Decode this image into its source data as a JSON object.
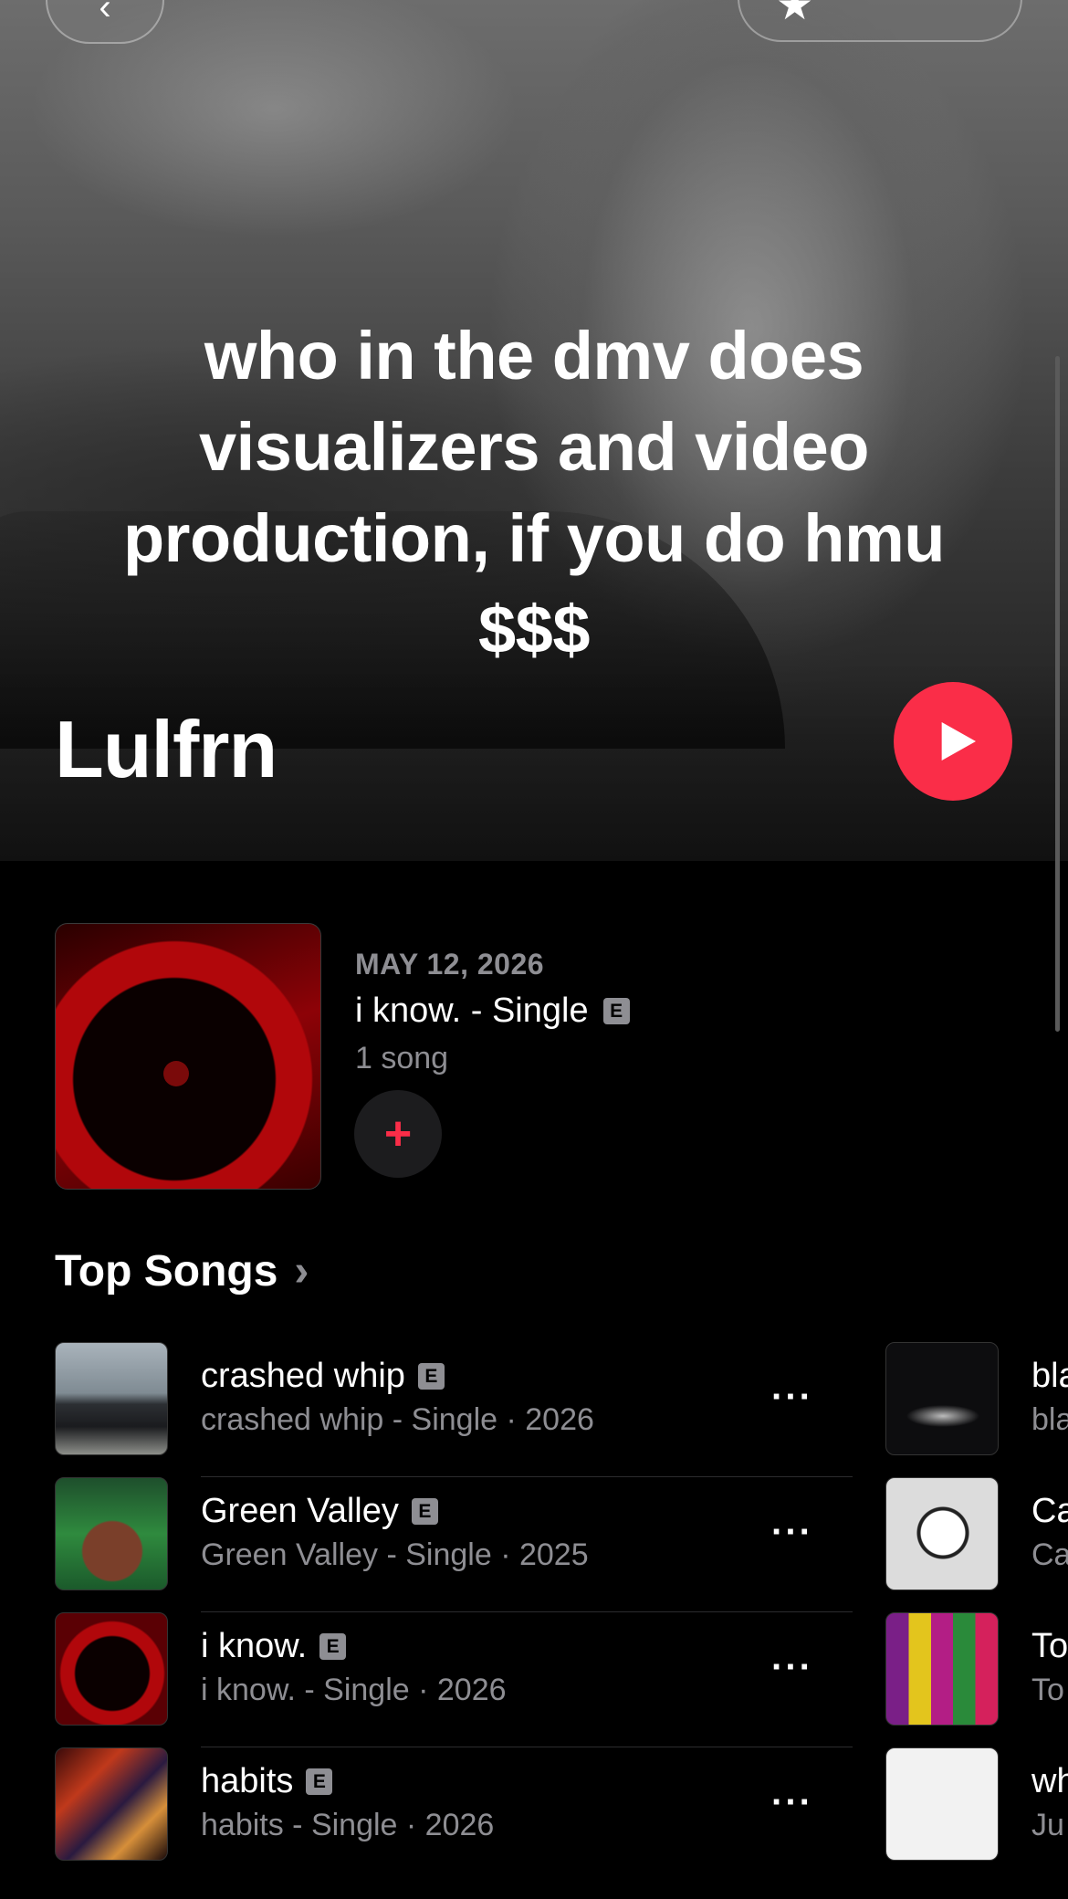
{
  "hero": {
    "quote": "who in the dmv does visualizers and video production, if you do hmu $$$",
    "artist_name": "Lulfrn"
  },
  "nav": {
    "back_icon": "chevron-left-icon",
    "star_icon": "star-icon"
  },
  "latest_release": {
    "date": "MAY 12, 2026",
    "title": "i know. - Single",
    "explicit": "E",
    "count": "1 song",
    "add_icon": "+"
  },
  "top_songs": {
    "title": "Top Songs",
    "chevron": "›",
    "songs": [
      {
        "title": "crashed whip",
        "explicit": "E",
        "subtitle": "crashed whip - Single · 2026",
        "more": "···"
      },
      {
        "title": "Green Valley",
        "explicit": "E",
        "subtitle": "Green Valley - Single · 2025",
        "more": "···"
      },
      {
        "title": "i know.",
        "explicit": "E",
        "subtitle": "i know. - Single · 2026",
        "more": "···"
      },
      {
        "title": "habits",
        "explicit": "E",
        "subtitle": "habits - Single · 2026",
        "more": "···"
      }
    ],
    "next_column": [
      {
        "title": "bla",
        "subtitle": "bla"
      },
      {
        "title": "Ca",
        "subtitle": "Ca"
      },
      {
        "title": "To",
        "subtitle": "To"
      },
      {
        "title": "wh",
        "subtitle": "Ju"
      }
    ]
  },
  "colors": {
    "accent": "#fa2d48",
    "secondary_text": "#8e8e93",
    "background": "#000000"
  }
}
